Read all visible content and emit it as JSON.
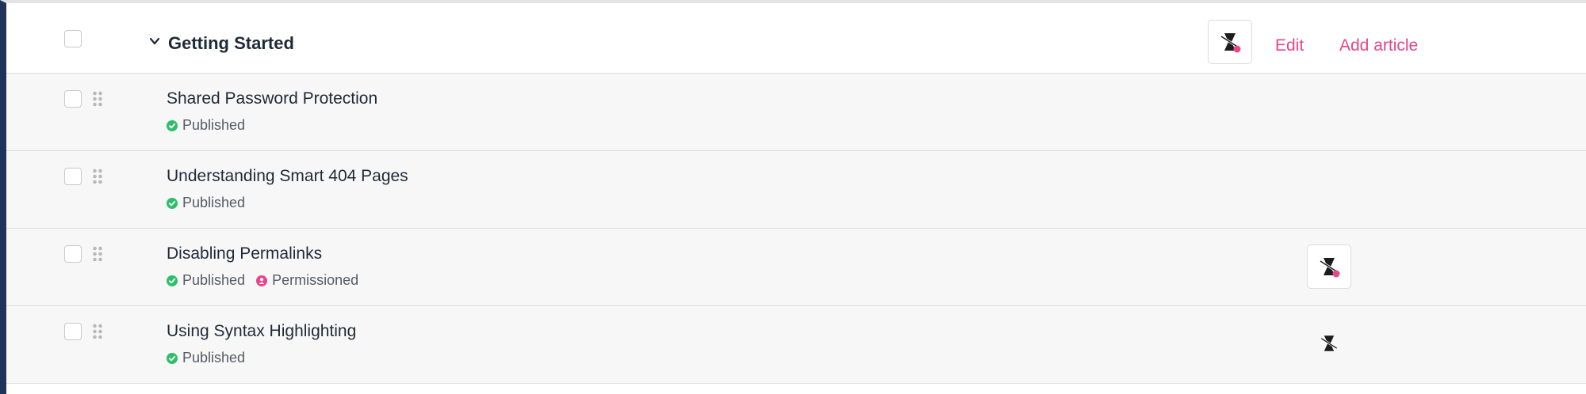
{
  "section": {
    "title": "Getting Started",
    "edit_label": "Edit",
    "add_article_label": "Add article",
    "icon": "no-robots-icon",
    "accent_color": "#e8458b"
  },
  "articles": [
    {
      "title": "Shared Password Protection",
      "status": "Published",
      "badges": []
    },
    {
      "title": "Understanding Smart 404 Pages",
      "status": "Published",
      "badges": []
    },
    {
      "title": "Disabling Permalinks",
      "status": "Published",
      "badges": [
        "Permissioned"
      ],
      "icon": "no-robots-icon"
    },
    {
      "title": "Using Syntax Highlighting",
      "status": "Published",
      "badges": [],
      "icon": "robots-icon"
    }
  ],
  "colors": {
    "published": "#2fbf6b",
    "permissioned": "#e8458b",
    "left_bar": "#1f3358"
  }
}
